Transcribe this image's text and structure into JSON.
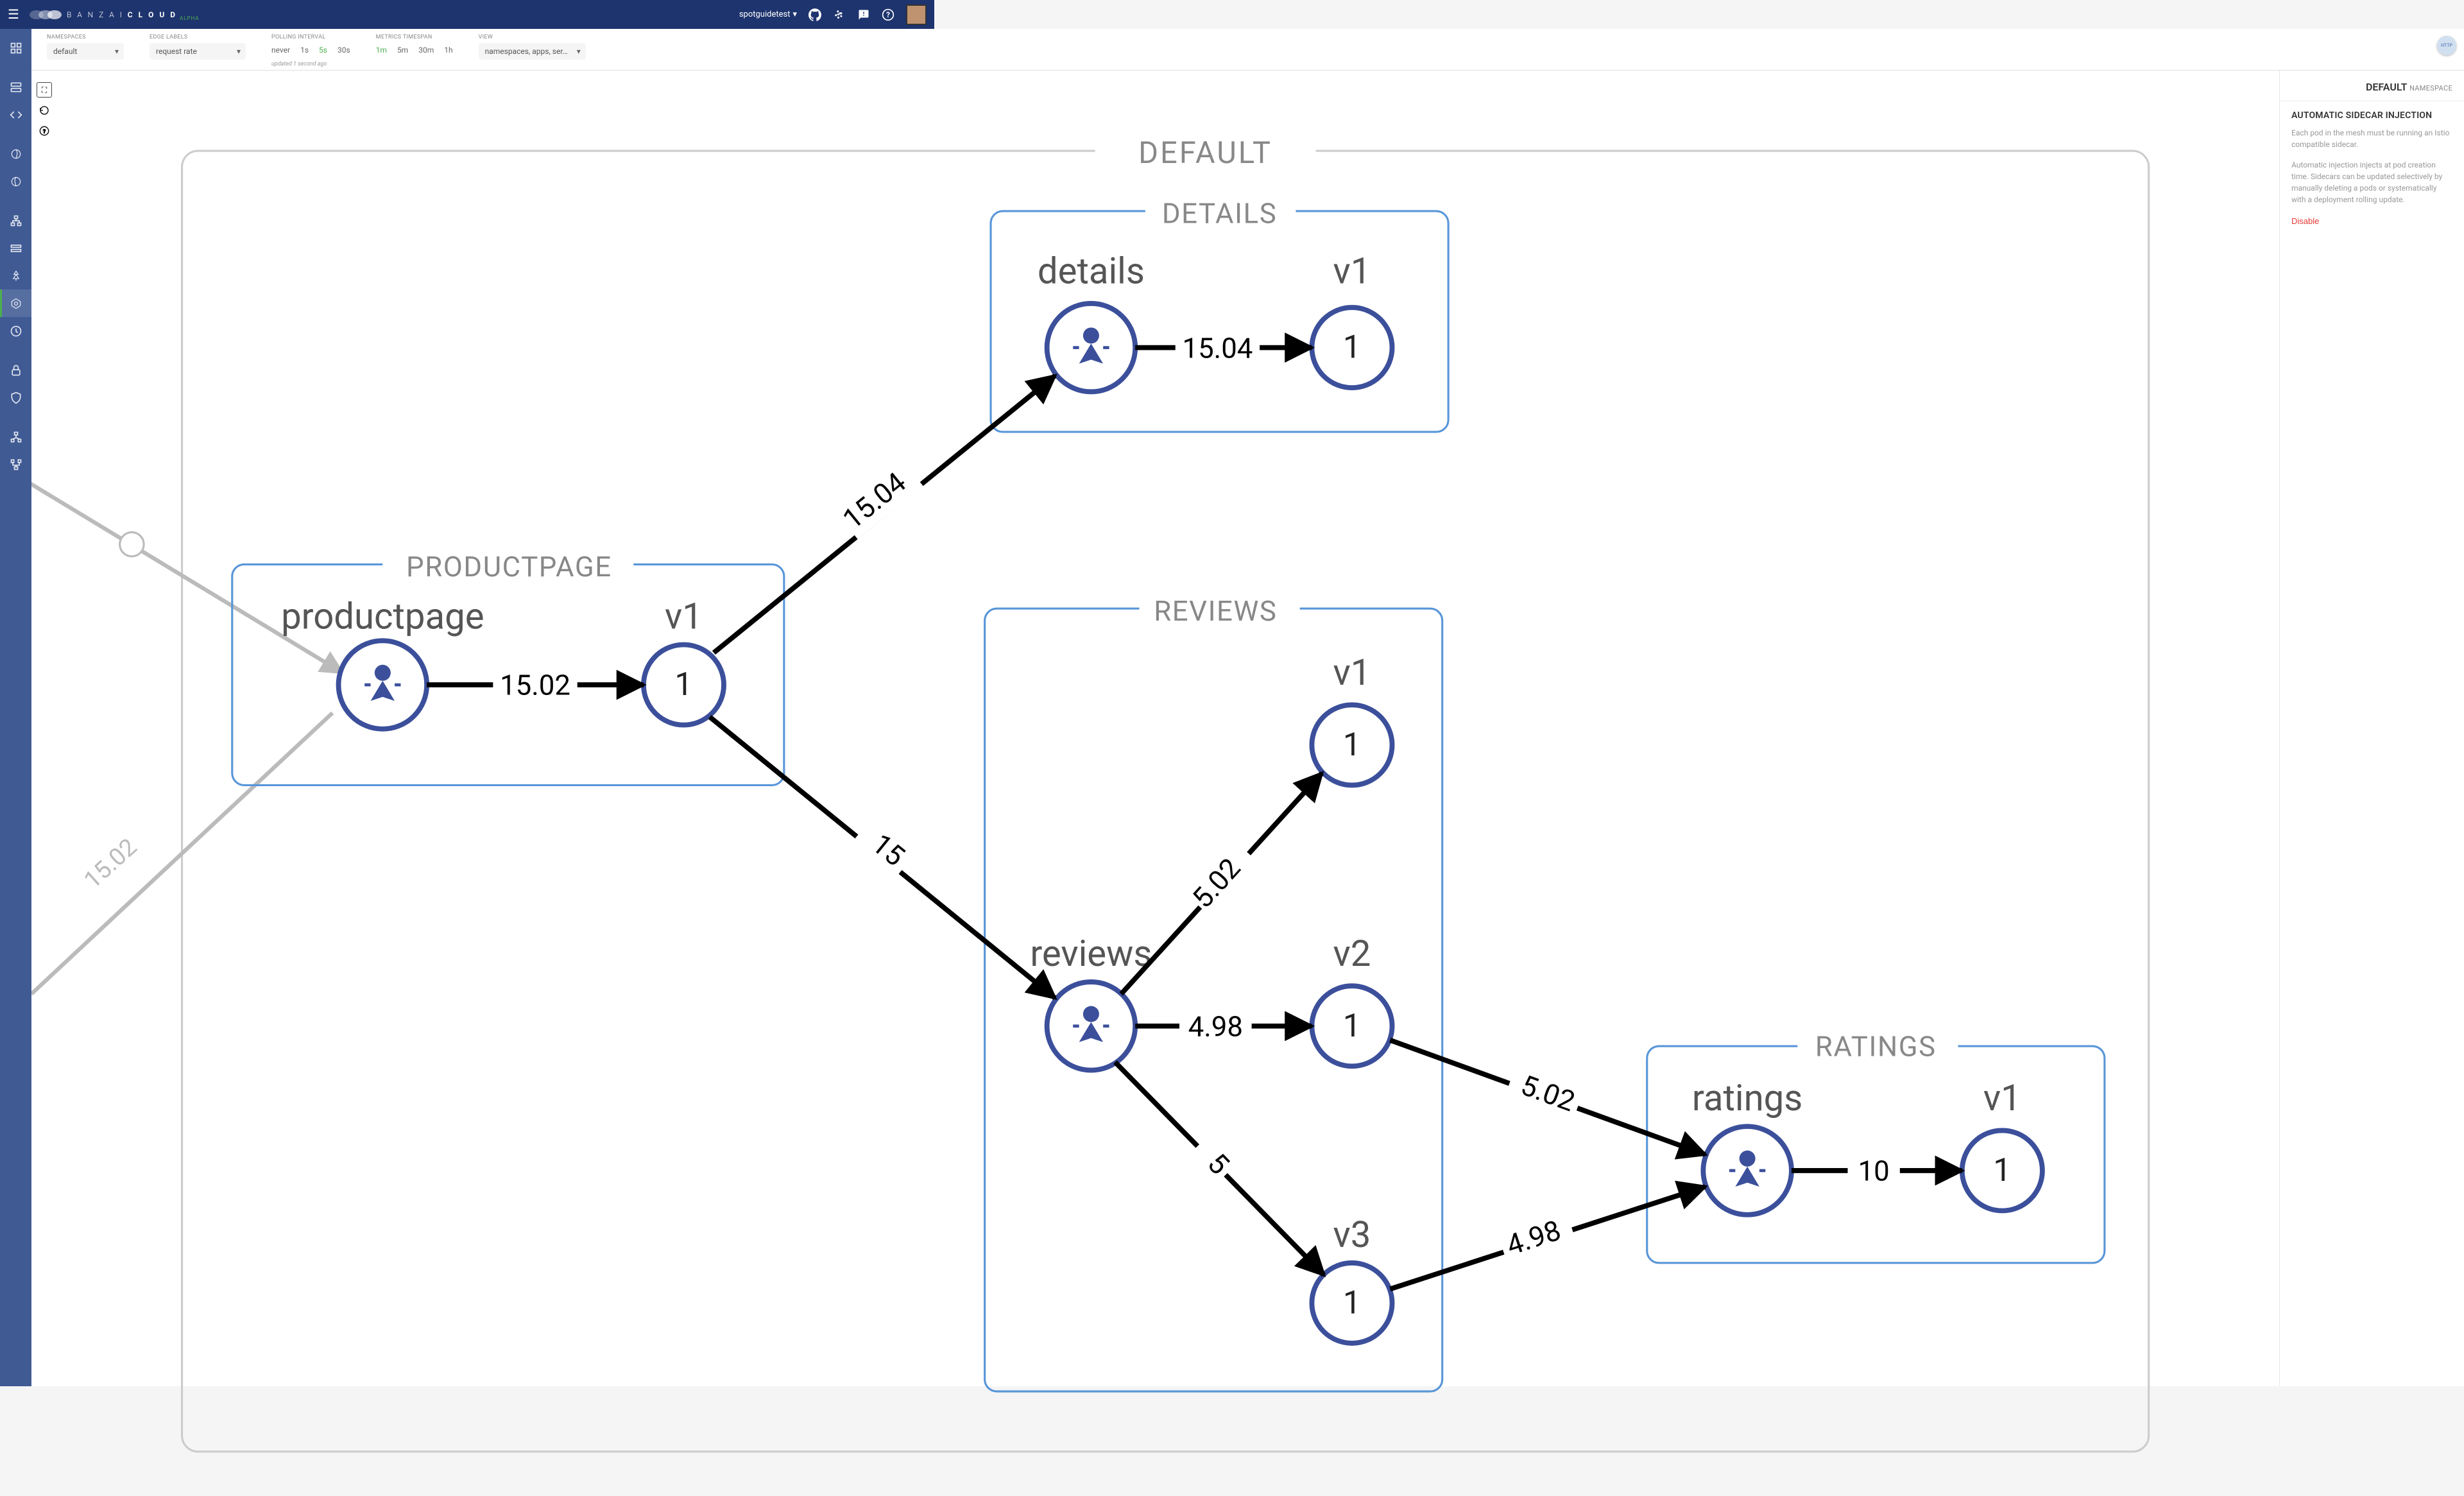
{
  "navbar": {
    "brand_left": "B A N Z A I",
    "brand_right": "C L O U D",
    "alpha": "ALPHA",
    "cluster": "spotguidetest"
  },
  "toolbar": {
    "labels": {
      "namespaces": "NAMESPACES",
      "edge_labels": "EDGE LABELS",
      "polling": "POLLING INTERVAL",
      "timespan": "METRICS TIMESPAN",
      "view": "VIEW"
    },
    "namespace": "default",
    "edge_labels": "request rate",
    "polling_options": [
      "never",
      "1s",
      "5s",
      "30s"
    ],
    "polling_active": "5s",
    "timespan_options": [
      "1m",
      "5m",
      "30m",
      "1h"
    ],
    "timespan_active": "1m",
    "view": "namespaces, apps, ser…",
    "updated": "updated 1 second ago"
  },
  "graph": {
    "namespace": "DEFAULT",
    "services": {
      "productpage": {
        "title": "PRODUCTPAGE",
        "name": "productpage",
        "versions": [
          "v1"
        ],
        "v1_count": "1"
      },
      "details": {
        "title": "DETAILS",
        "name": "details",
        "versions": [
          "v1"
        ],
        "v1_count": "1"
      },
      "reviews": {
        "title": "REVIEWS",
        "name": "reviews",
        "versions": [
          "v1",
          "v2",
          "v3"
        ],
        "v1c": "1",
        "v2c": "1",
        "v3c": "1"
      },
      "ratings": {
        "title": "RATINGS",
        "name": "ratings",
        "versions": [
          "v1"
        ],
        "v1_count": "1"
      }
    },
    "edges": {
      "in_pp": "15.02",
      "pp_v1": "15.02",
      "pp_details": "15.04",
      "details_v1": "15.04",
      "pp_reviews": "15",
      "reviews_v1": "5.02",
      "reviews_v2": "4.98",
      "reviews_v3": "5",
      "v2_ratings": "5.02",
      "v3_ratings": "4.98",
      "ratings_v1": "10"
    },
    "v1": "v1",
    "v2": "v2",
    "v3": "v3"
  },
  "panel": {
    "title": "DEFAULT",
    "subtitle": "NAMESPACE",
    "h2": "AUTOMATIC SIDECAR INJECTION",
    "p1": "Each pod in the mesh must be running an Istio compatible sidecar.",
    "p2": "Automatic injection injects at pod creation time. Sidecars can be updated selectively by manually deleting a pods or systematically with a deployment rolling update.",
    "disable": "Disable"
  },
  "http_badge": "HTTP"
}
